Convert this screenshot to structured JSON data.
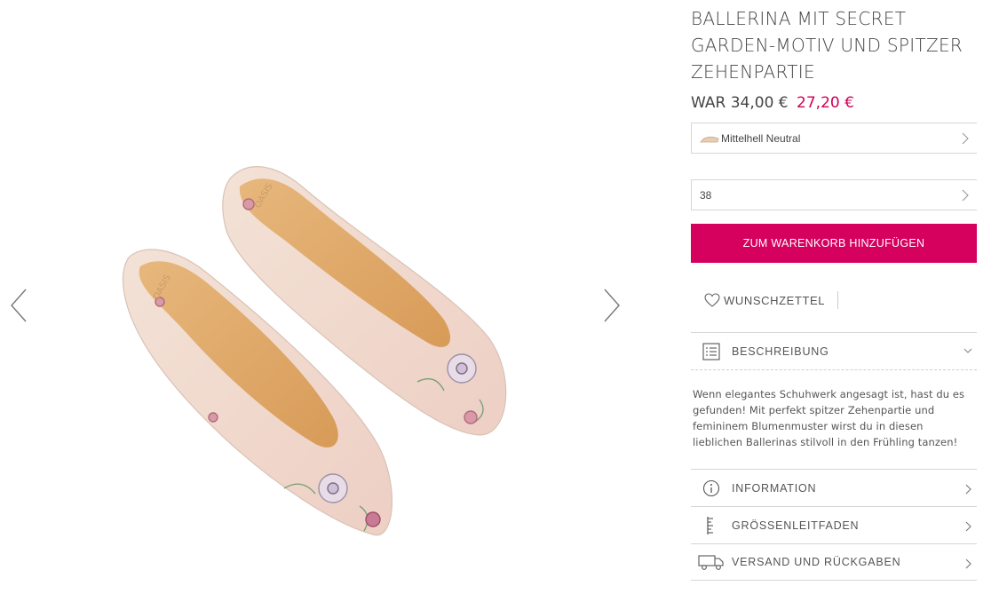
{
  "gallery": {
    "prev_icon": "chevron-left-icon",
    "next_icon": "chevron-right-icon",
    "insole_brand": "OASIS"
  },
  "product": {
    "title_line1": "BALLERINA MIT SECRET",
    "title_line2": "GARDEN-MOTIV UND SPITZER",
    "title_line3": "ZEHENPARTIE",
    "price_was_label": "WAR",
    "price_old": "34,00 €",
    "price_new": "27,20 €",
    "sale_color": "#d0005a"
  },
  "color_select": {
    "value": "Mittelhell Neutral",
    "icon": "chevron-right-icon"
  },
  "size_select": {
    "value": "38",
    "icon": "chevron-right-icon"
  },
  "cart_button": {
    "label": "ZUM WARENKORB HINZUFÜGEN",
    "color": "#d6005f"
  },
  "wishlist": {
    "label": "WUNSCHZETTEL",
    "icon": "heart-icon"
  },
  "description": {
    "heading": "BESCHREIBUNG",
    "icon": "list-icon",
    "text": "Wenn elegantes Schuhwerk angesagt ist, hast du es gefunden! Mit perfekt spitzer Zehenpartie und femininem Blumenmuster wirst du in diesen lieblichen Ballerinas stilvoll in den Frühling tanzen!"
  },
  "links": [
    {
      "label": "INFORMATION",
      "icon": "info-icon"
    },
    {
      "label": "GRÖSSENLEITFADEN",
      "icon": "ruler-icon"
    },
    {
      "label": "VERSAND UND RÜCKGABEN",
      "icon": "truck-icon"
    }
  ]
}
